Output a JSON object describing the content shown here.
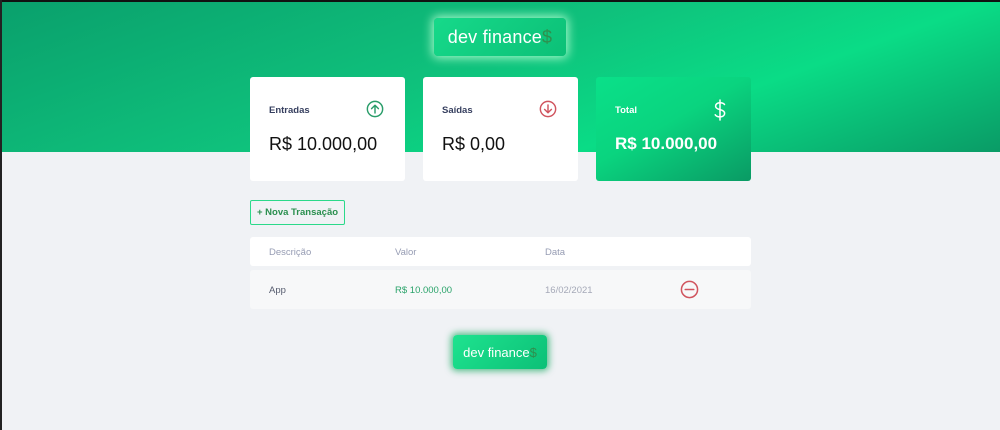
{
  "header": {
    "logo_text": "dev finance",
    "logo_symbol": "$",
    "accent": "#0fc17c"
  },
  "cards": {
    "income": {
      "label": "Entradas",
      "value": "R$ 10.000,00",
      "icon": "arrow-up-circle-icon",
      "color": "#2a9d6a"
    },
    "expense": {
      "label": "Saídas",
      "value": "R$ 0,00",
      "icon": "arrow-down-circle-icon",
      "color": "#d0555f"
    },
    "total": {
      "label": "Total",
      "value": "R$ 10.000,00",
      "icon": "dollar-icon"
    }
  },
  "actions": {
    "new_transaction": "+ Nova Transação"
  },
  "table": {
    "headers": {
      "description": "Descrição",
      "value": "Valor",
      "date": "Data"
    },
    "rows": [
      {
        "description": "App",
        "value": "R$ 10.000,00",
        "date": "16/02/2021",
        "action_icon": "minus-circle-icon"
      }
    ]
  },
  "footer": {
    "logo_text": "dev finance",
    "logo_symbol": "$"
  }
}
